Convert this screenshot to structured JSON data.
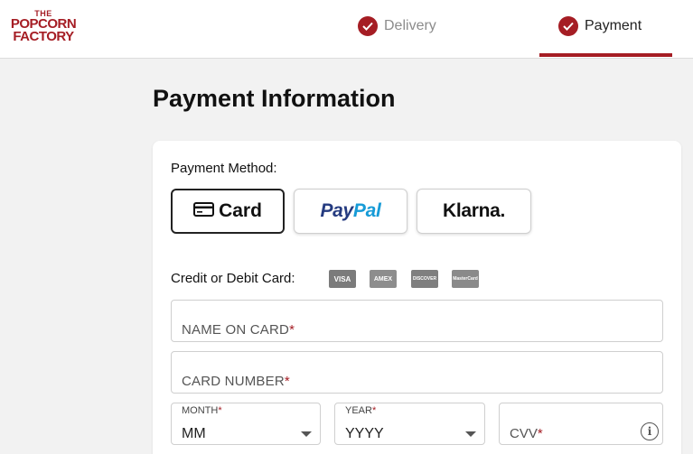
{
  "header": {
    "logo": {
      "line1": "THE",
      "line2": "POPCORN",
      "line3": "FACTORY"
    },
    "steps": [
      {
        "label": "Delivery",
        "state": "complete"
      },
      {
        "label": "Payment",
        "state": "active"
      }
    ]
  },
  "main": {
    "title": "Payment Information",
    "payment_method_label": "Payment Method:",
    "methods": {
      "card": "Card",
      "paypal_pay": "Pay",
      "paypal_pal": "Pal",
      "klarna": "Klarna."
    },
    "card_label": "Credit or Debit Card:",
    "card_brands": [
      "VISA",
      "AMEX",
      "DISCOVER",
      "MasterCard"
    ],
    "fields": {
      "name_placeholder": "NAME ON CARD",
      "number_placeholder": "CARD NUMBER",
      "month_label": "MONTH",
      "month_value": "MM",
      "year_label": "YEAR",
      "year_value": "YYYY",
      "cvv_placeholder": "CVV",
      "required_mark": "*"
    }
  },
  "colors": {
    "brand": "#a51d24",
    "paypal_dark": "#253b80",
    "paypal_light": "#179bd7"
  }
}
